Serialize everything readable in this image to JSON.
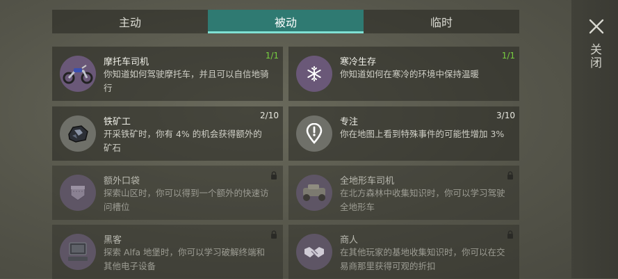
{
  "tabs": [
    {
      "label": "主动"
    },
    {
      "label": "被动"
    },
    {
      "label": "临时"
    }
  ],
  "close": {
    "label": "关闭"
  },
  "colors": {
    "accent": "#2f7a72",
    "accent_line": "#7fe0d4",
    "count_max": "#78d040"
  },
  "skills": [
    {
      "title": "摩托车司机",
      "desc": "你知道如何驾驶摩托车，并且可以自信地骑行",
      "count": "1/1",
      "icon": "motorcycle-icon",
      "locked": false
    },
    {
      "title": "寒冷生存",
      "desc": "你知道如何在寒冷的环境中保持温暖",
      "count": "1/1",
      "icon": "snowflake-icon",
      "locked": false
    },
    {
      "title": "铁矿工",
      "desc": "开采铁矿时，你有 4% 的机会获得额外的矿石",
      "count": "2/10",
      "icon": "iron-ore-icon",
      "locked": false
    },
    {
      "title": "专注",
      "desc": "你在地图上看到特殊事件的可能性增加 3%",
      "count": "3/10",
      "icon": "map-marker-icon",
      "locked": false
    },
    {
      "title": "额外口袋",
      "desc": "探索山区时，你可以得到一个额外的快速访问槽位",
      "count": "",
      "icon": "pocket-icon",
      "locked": true
    },
    {
      "title": "全地形车司机",
      "desc": "在北方森林中收集知识时，你可以学习驾驶全地形车",
      "count": "",
      "icon": "atv-icon",
      "locked": true
    },
    {
      "title": "黑客",
      "desc": "探索 Alfa 地堡时，你可以学习破解终端和其他电子设备",
      "count": "",
      "icon": "computer-icon",
      "locked": true
    },
    {
      "title": "商人",
      "desc": "在其他玩家的基地收集知识时，你可以在交易商那里获得可观的折扣",
      "count": "",
      "icon": "handshake-icon",
      "locked": true
    }
  ]
}
